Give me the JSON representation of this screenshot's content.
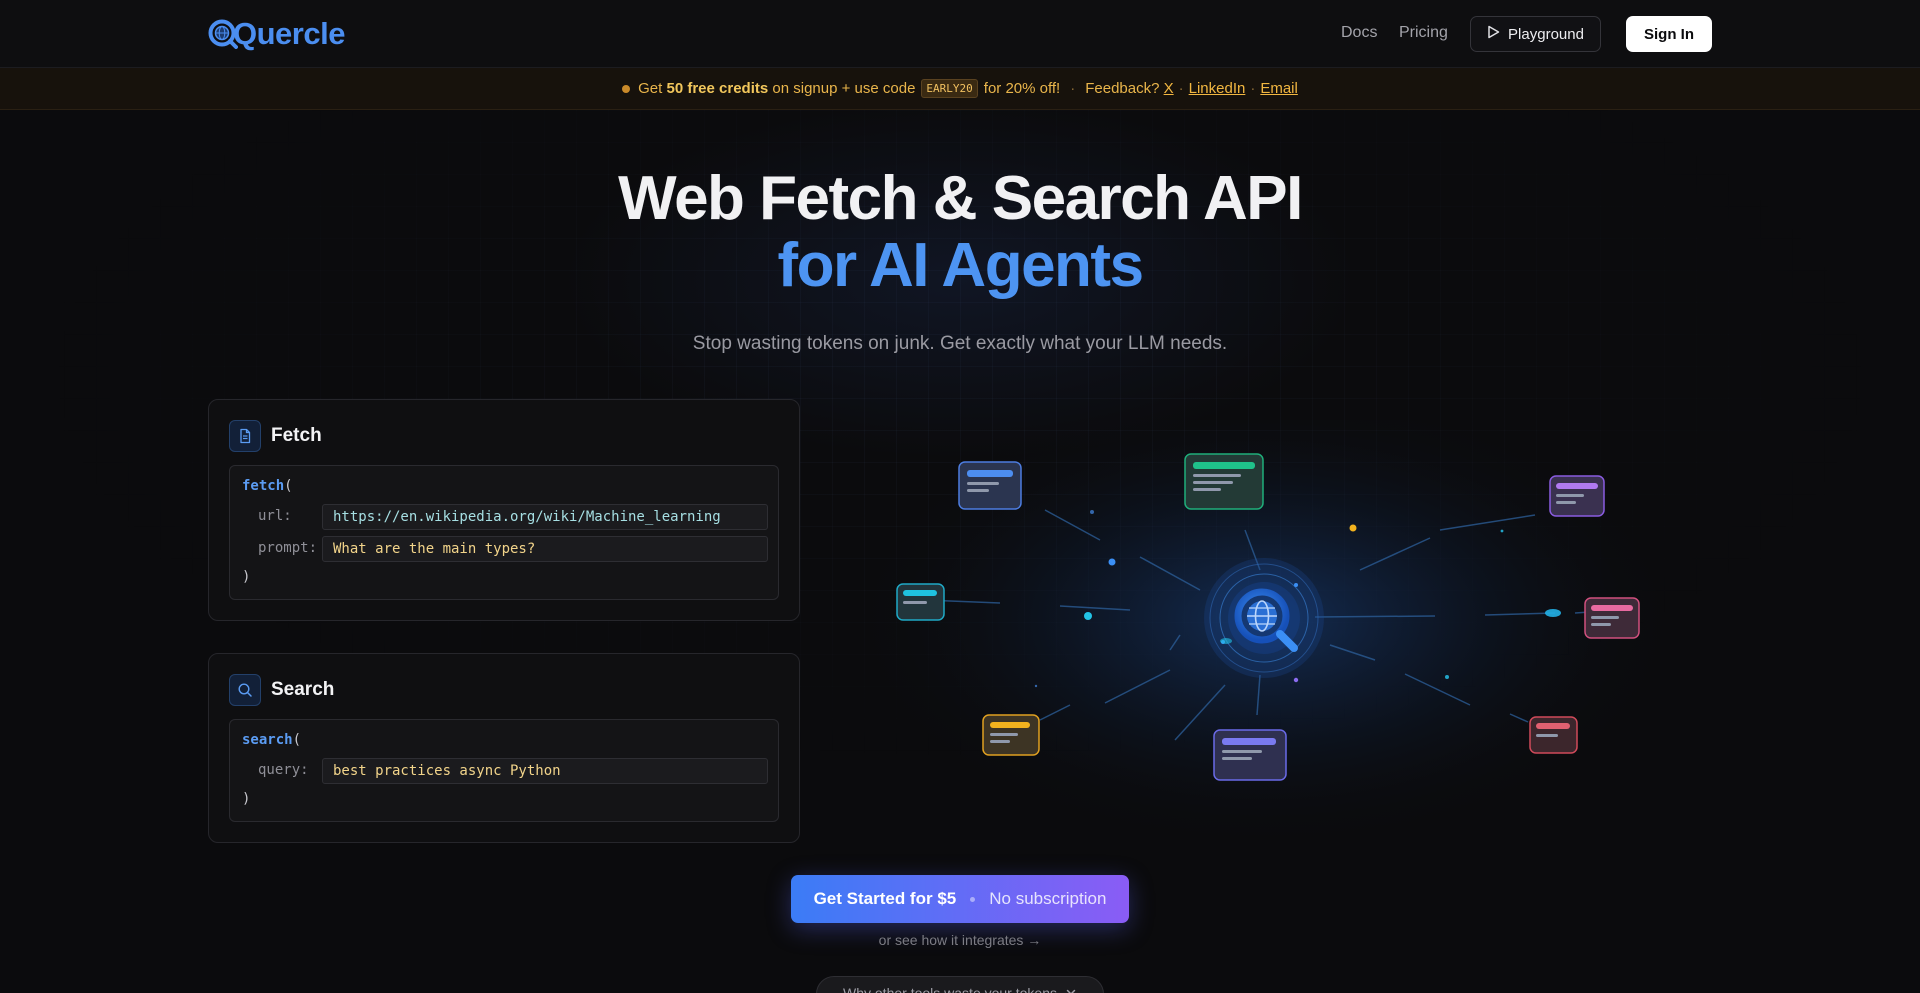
{
  "header": {
    "logo": "Quercle",
    "nav": {
      "docs": "Docs",
      "pricing": "Pricing",
      "playground": "Playground",
      "sign_in": "Sign In"
    }
  },
  "banner": {
    "pre": "Get",
    "credits": "50 free credits",
    "mid": "on signup + use code",
    "code": "EARLY20",
    "post": "for 20% off!",
    "sep": "·",
    "feedback": "Feedback?",
    "link_x": "X",
    "link_linkedin": "LinkedIn",
    "link_email": "Email",
    "dot": "·"
  },
  "hero": {
    "title_line1": "Web Fetch & Search API",
    "title_line2": "for AI Agents",
    "subtitle": "Stop wasting tokens on junk. Get exactly what your LLM needs."
  },
  "fetch_card": {
    "title": "Fetch",
    "fn": "fetch",
    "open": "(",
    "close": ")",
    "url_label": "url:",
    "url_value": "https://en.wikipedia.org/wiki/Machine_learning",
    "prompt_label": "prompt:",
    "prompt_value": "What are the main types?"
  },
  "search_card": {
    "title": "Search",
    "fn": "search",
    "open": "(",
    "close": ")",
    "query_label": "query:",
    "query_value": "best practices async Python"
  },
  "cta": {
    "main": "Get Started for $5",
    "sub": "No subscription",
    "integrate": "or see how it integrates →",
    "why": "Why other tools waste your tokens"
  },
  "colors": {
    "accent_blue": "#4d94f2",
    "banner_gold": "#f2c75c",
    "cta_start": "#3b7cf6",
    "cta_end": "#8a5cf5"
  },
  "icons": {
    "logo": "magnifier-globe-icon",
    "playground": "play-icon",
    "fetch": "document-icon",
    "search": "search-icon",
    "why": "chevron-down-icon"
  }
}
